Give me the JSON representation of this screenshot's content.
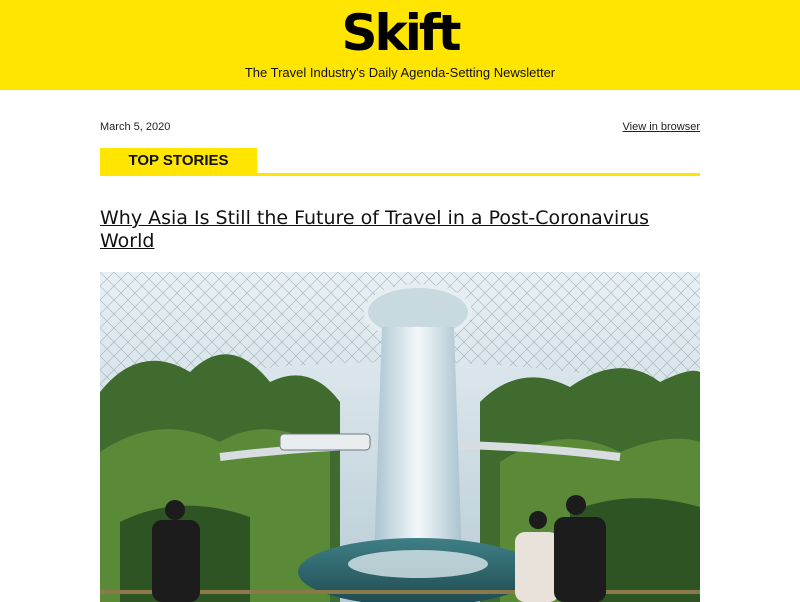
{
  "header": {
    "logo": "Skift",
    "tagline": "The Travel Industry's Daily Agenda-Setting Newsletter"
  },
  "meta": {
    "date": "March 5, 2020",
    "view_in_browser": "View in browser"
  },
  "section": {
    "label": "TOP STORIES"
  },
  "story": {
    "headline": "Why Asia Is Still the Future of Travel in a Post-Coronavirus World"
  },
  "colors": {
    "brand_yellow": "#ffe500"
  }
}
